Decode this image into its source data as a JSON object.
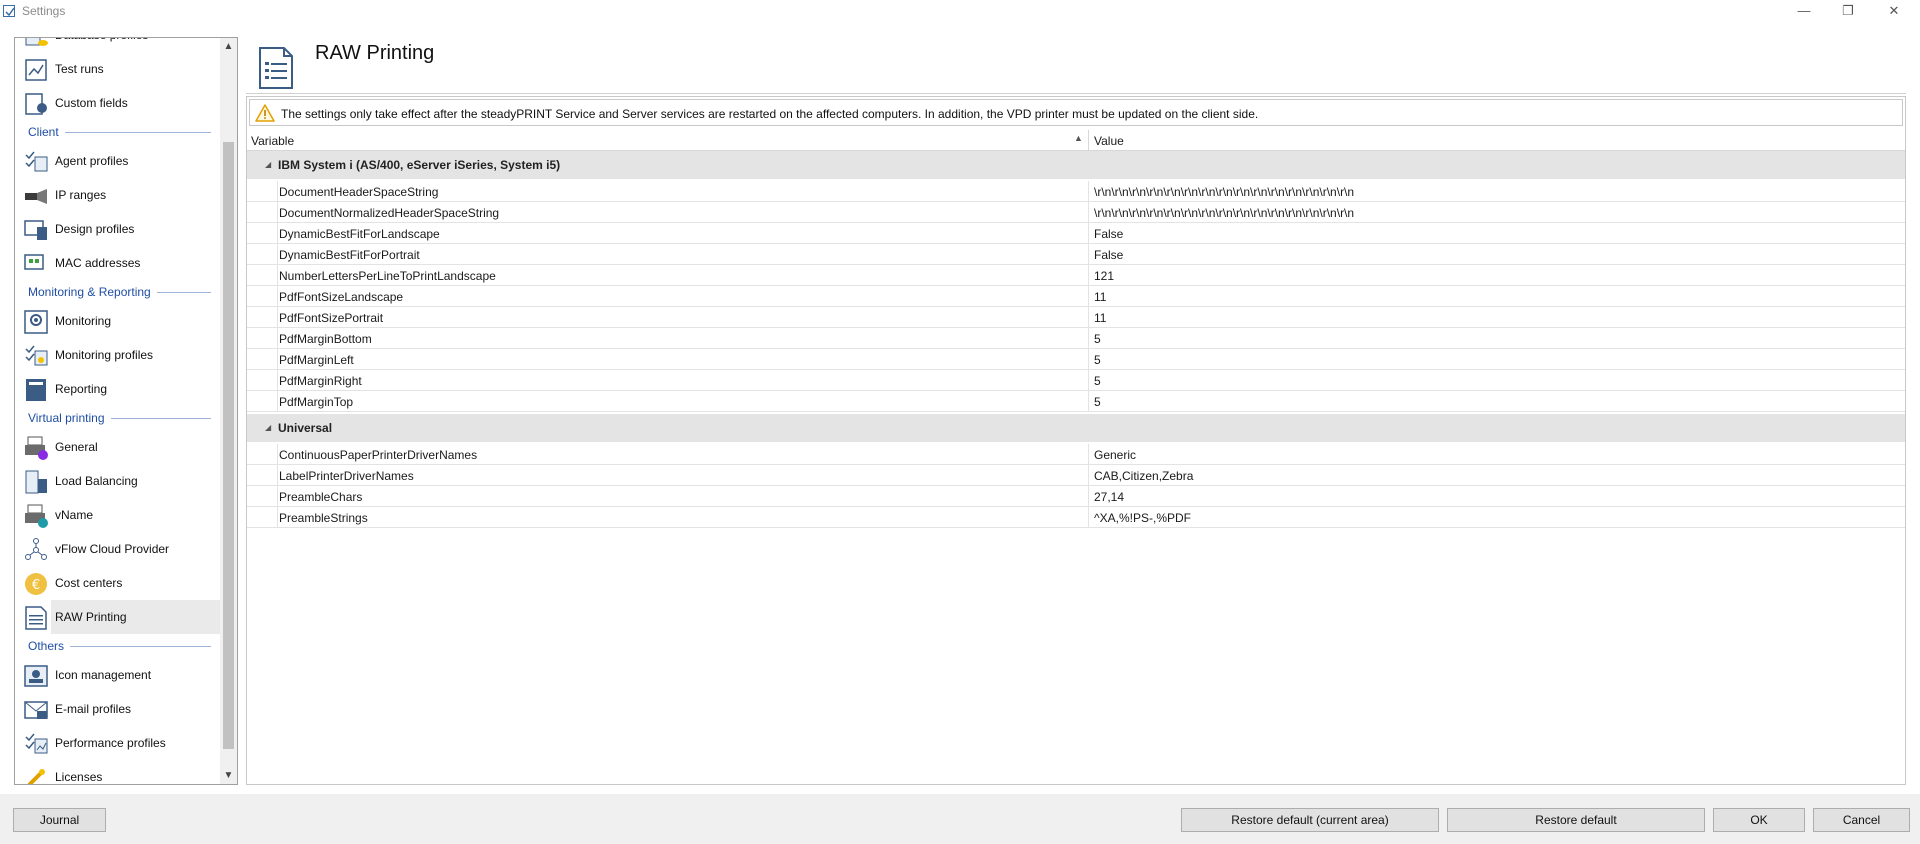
{
  "window": {
    "title": "Settings"
  },
  "page": {
    "title": "RAW Printing"
  },
  "nav": {
    "entries": [
      {
        "kind": "item",
        "label": "Database profiles",
        "icon": "database-profiles-icon"
      },
      {
        "kind": "item",
        "label": "Test runs",
        "icon": "test-runs-icon"
      },
      {
        "kind": "item",
        "label": "Custom fields",
        "icon": "custom-fields-icon"
      },
      {
        "kind": "section",
        "label": "Client"
      },
      {
        "kind": "item",
        "label": "Agent profiles",
        "icon": "agent-profiles-icon"
      },
      {
        "kind": "item",
        "label": "IP ranges",
        "icon": "ip-ranges-icon"
      },
      {
        "kind": "item",
        "label": "Design profiles",
        "icon": "design-profiles-icon"
      },
      {
        "kind": "item",
        "label": "MAC addresses",
        "icon": "mac-addresses-icon"
      },
      {
        "kind": "section",
        "label": "Monitoring & Reporting"
      },
      {
        "kind": "item",
        "label": "Monitoring",
        "icon": "monitoring-icon"
      },
      {
        "kind": "item",
        "label": "Monitoring profiles",
        "icon": "monitoring-profiles-icon"
      },
      {
        "kind": "item",
        "label": "Reporting",
        "icon": "reporting-icon"
      },
      {
        "kind": "section",
        "label": "Virtual printing"
      },
      {
        "kind": "item",
        "label": "General",
        "icon": "printer-icon"
      },
      {
        "kind": "item",
        "label": "Load Balancing",
        "icon": "load-balancing-icon"
      },
      {
        "kind": "item",
        "label": "vName",
        "icon": "vname-icon"
      },
      {
        "kind": "item",
        "label": "vFlow Cloud Provider",
        "icon": "vflow-icon"
      },
      {
        "kind": "item",
        "label": "Cost centers",
        "icon": "cost-centers-icon"
      },
      {
        "kind": "item",
        "label": "RAW Printing",
        "icon": "raw-printing-icon",
        "active": true
      },
      {
        "kind": "section",
        "label": "Others"
      },
      {
        "kind": "item",
        "label": "Icon management",
        "icon": "icon-management-icon"
      },
      {
        "kind": "item",
        "label": "E-mail profiles",
        "icon": "email-profiles-icon"
      },
      {
        "kind": "item",
        "label": "Performance profiles",
        "icon": "performance-profiles-icon"
      },
      {
        "kind": "item",
        "label": "Licenses",
        "icon": "licenses-icon"
      }
    ]
  },
  "warning": {
    "icon": "warning-icon",
    "text": "The settings only take effect after the steadyPRINT Service and Server services are restarted on the affected computers. In addition, the VPD printer must be updated on the client side."
  },
  "grid": {
    "columns": [
      "Variable",
      "Value"
    ],
    "groups": [
      {
        "name": "IBM System i (AS/400, eServer iSeries, System i5)",
        "rows": [
          {
            "variable": "DocumentHeaderSpaceString",
            "value": "\\r\\n\\r\\n\\r\\n\\r\\n\\r\\n\\r\\n\\r\\n\\r\\n\\r\\n\\r\\n\\r\\n\\r\\n\\r\\n\\r\\n\\r\\n"
          },
          {
            "variable": "DocumentNormalizedHeaderSpaceString",
            "value": "\\r\\n\\r\\n\\r\\n\\r\\n\\r\\n\\r\\n\\r\\n\\r\\n\\r\\n\\r\\n\\r\\n\\r\\n\\r\\n\\r\\n\\r\\n"
          },
          {
            "variable": "DynamicBestFitForLandscape",
            "value": "False"
          },
          {
            "variable": "DynamicBestFitForPortrait",
            "value": "False"
          },
          {
            "variable": "NumberLettersPerLineToPrintLandscape",
            "value": "121"
          },
          {
            "variable": "PdfFontSizeLandscape",
            "value": "11"
          },
          {
            "variable": "PdfFontSizePortrait",
            "value": "11"
          },
          {
            "variable": "PdfMarginBottom",
            "value": "5"
          },
          {
            "variable": "PdfMarginLeft",
            "value": "5"
          },
          {
            "variable": "PdfMarginRight",
            "value": "5"
          },
          {
            "variable": "PdfMarginTop",
            "value": "5"
          }
        ]
      },
      {
        "name": "Universal",
        "rows": [
          {
            "variable": "ContinuousPaperPrinterDriverNames",
            "value": "Generic"
          },
          {
            "variable": "LabelPrinterDriverNames",
            "value": "CAB,Citizen,Zebra"
          },
          {
            "variable": "PreambleChars",
            "value": "27,14"
          },
          {
            "variable": "PreambleStrings",
            "value": "^XA,%!PS-,%PDF"
          }
        ]
      }
    ]
  },
  "buttons": {
    "journal": "Journal",
    "restore_current": "Restore default (current area)",
    "restore_default": "Restore default",
    "ok": "OK",
    "cancel": "Cancel"
  }
}
